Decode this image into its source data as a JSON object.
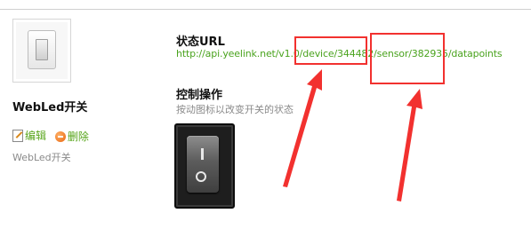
{
  "device": {
    "name": "WebLed开关",
    "description": "WebLed开关",
    "actions": {
      "edit": "编辑",
      "delete": "删除"
    }
  },
  "status": {
    "label": "状态URL",
    "url": "http://api.yeelink.net/v1.0/device/344482/sensor/382935/datapoints"
  },
  "control": {
    "label": "控制操作",
    "hint": "按动图标以改变开关的状态"
  },
  "colors": {
    "link": "#4aa31e",
    "annotation": "#f2312f"
  },
  "icons": [
    "light-switch-icon",
    "edit-icon",
    "delete-icon",
    "rocker-switch-icon"
  ]
}
